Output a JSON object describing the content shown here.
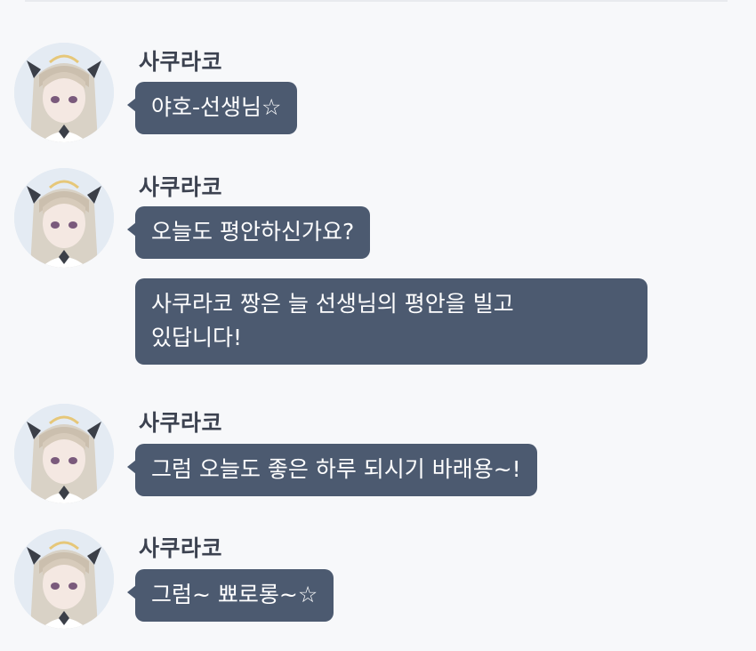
{
  "colors": {
    "background": "#f7f8fa",
    "bubble": "#4c5a70",
    "bubble_text": "#ffffff",
    "sender_text": "#3c4250"
  },
  "groups": [
    {
      "sender": "사쿠라코",
      "avatar_icon": "character-avatar-icon",
      "messages": [
        "야호-선생님☆"
      ]
    },
    {
      "sender": "사쿠라코",
      "avatar_icon": "character-avatar-icon",
      "messages": [
        "오늘도 평안하신가요?",
        "사쿠라코 짱은 늘 선생님의 평안을 빌고\n있답니다!"
      ]
    },
    {
      "sender": "사쿠라코",
      "avatar_icon": "character-avatar-icon",
      "messages": [
        "그럼 오늘도 좋은 하루 되시기 바래용~!"
      ]
    },
    {
      "sender": "사쿠라코",
      "avatar_icon": "character-avatar-icon",
      "messages": [
        "그럼~ 뾰로롱~☆"
      ]
    }
  ]
}
